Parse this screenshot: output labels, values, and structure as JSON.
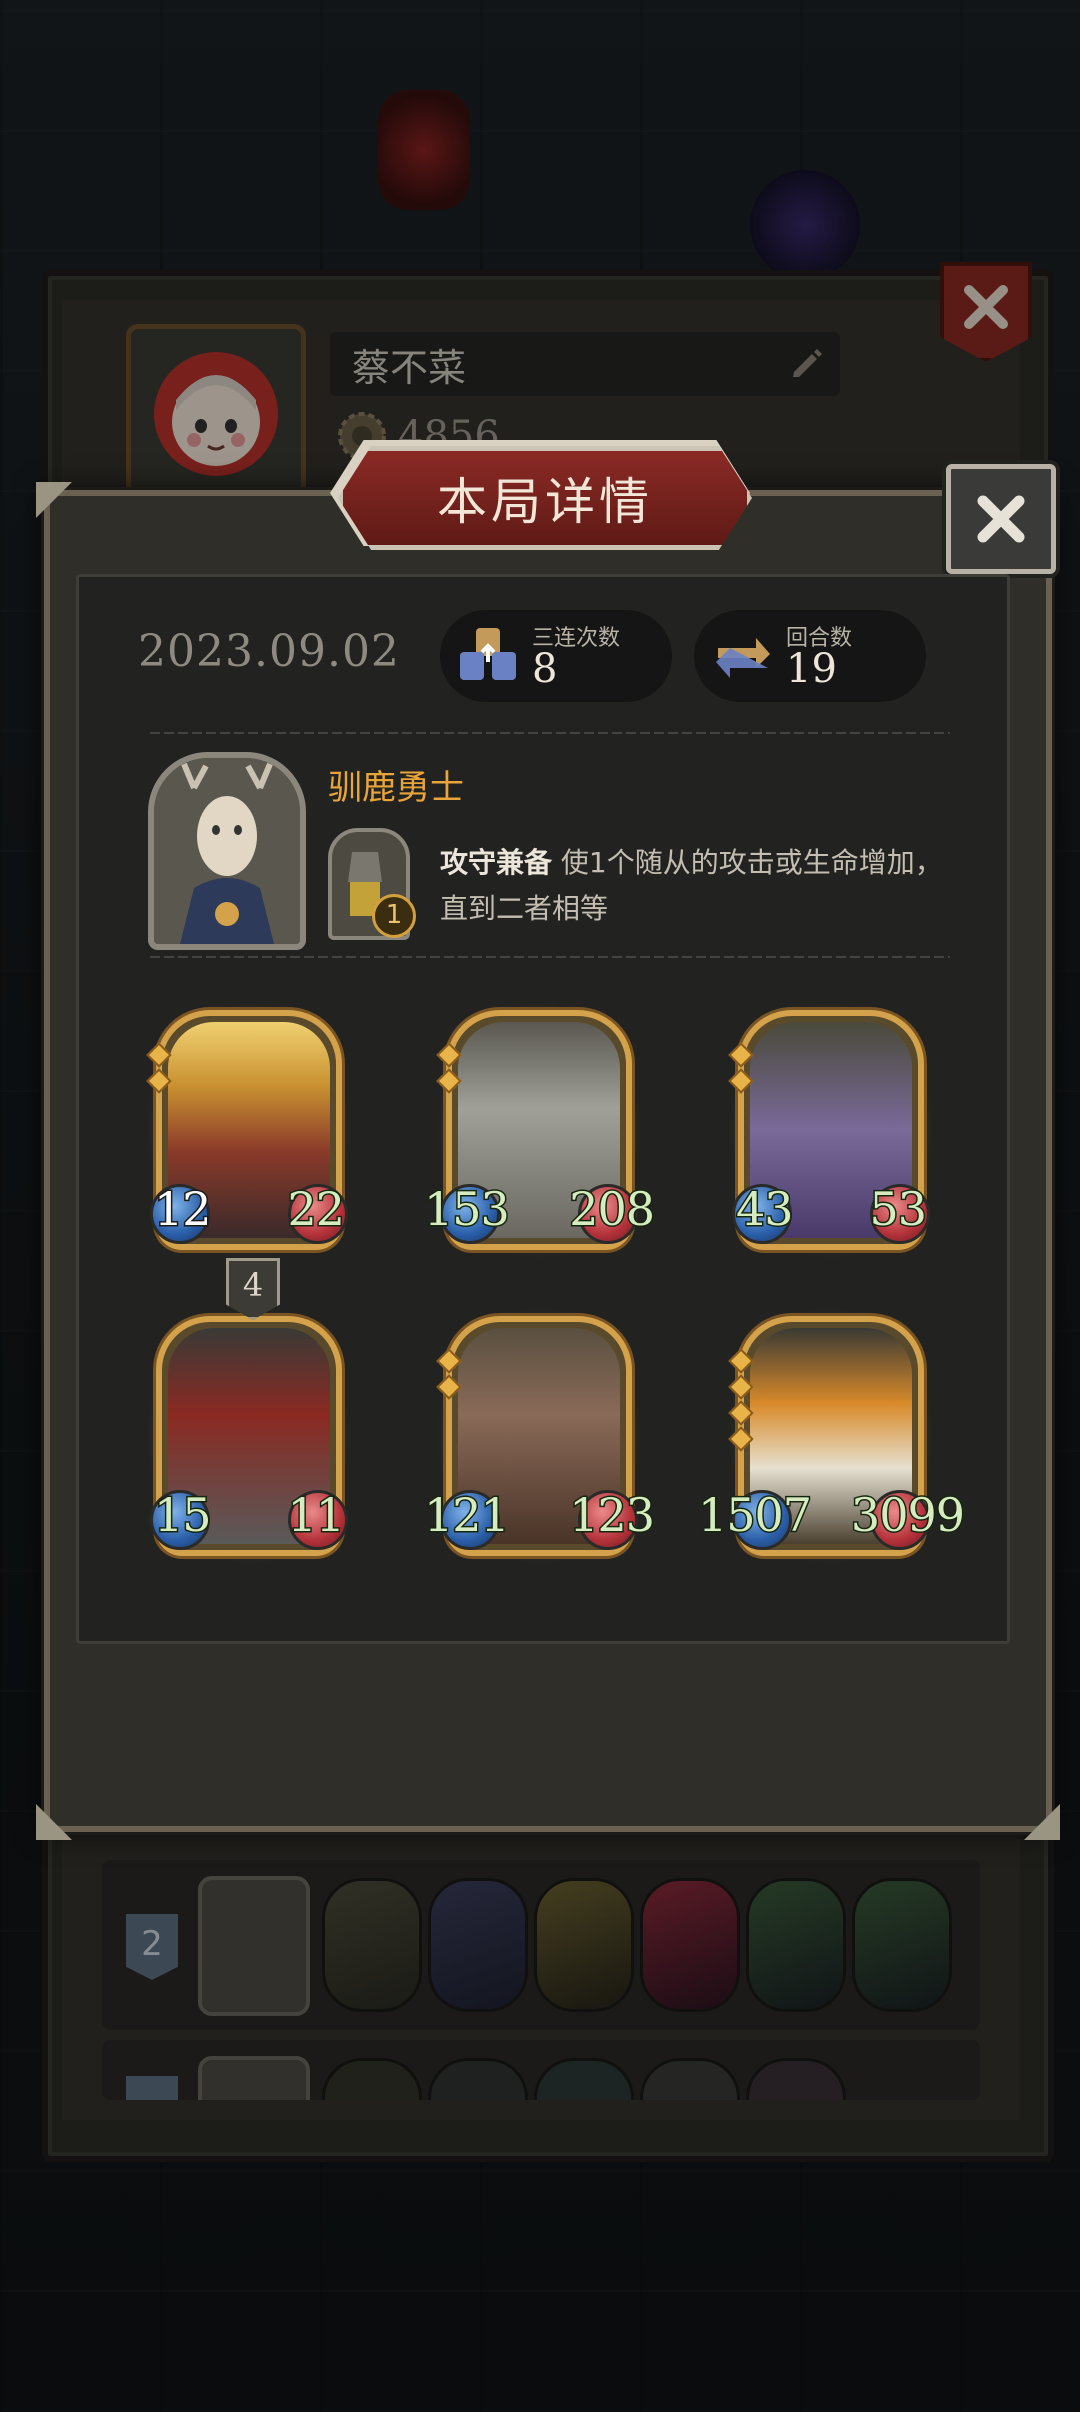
{
  "profile": {
    "name": "蔡不菜",
    "coins_partial": "4856"
  },
  "dialog": {
    "title": "本局详情",
    "date": "2023.09.02",
    "stats": [
      {
        "label": "三连次数",
        "value": "8"
      },
      {
        "label": "回合数",
        "value": "19"
      }
    ],
    "hero": {
      "name": "驯鹿勇士",
      "skill_level": "1",
      "skill_name": "攻守兼备",
      "skill_text": "使1个随从的攻击或生命增加，直到二者相等"
    },
    "cards": [
      {
        "attack": "12",
        "health": "22",
        "stars": 2,
        "level": ""
      },
      {
        "attack": "153",
        "health": "208",
        "stars": 2,
        "level": ""
      },
      {
        "attack": "43",
        "health": "53",
        "stars": 2,
        "level": ""
      },
      {
        "attack": "15",
        "health": "11",
        "stars": 0,
        "level": "4"
      },
      {
        "attack": "121",
        "health": "123",
        "stars": 2,
        "level": ""
      },
      {
        "attack": "1507",
        "health": "3099",
        "stars": 4,
        "level": ""
      }
    ]
  },
  "background_rows": [
    {
      "rank": "2"
    },
    {
      "rank": ""
    }
  ],
  "colors": {
    "accent_gold": "#d3a24a",
    "title_red": "#8b2a25",
    "hero_name": "#e9a43a",
    "stat_number": "#d6ecc0"
  }
}
